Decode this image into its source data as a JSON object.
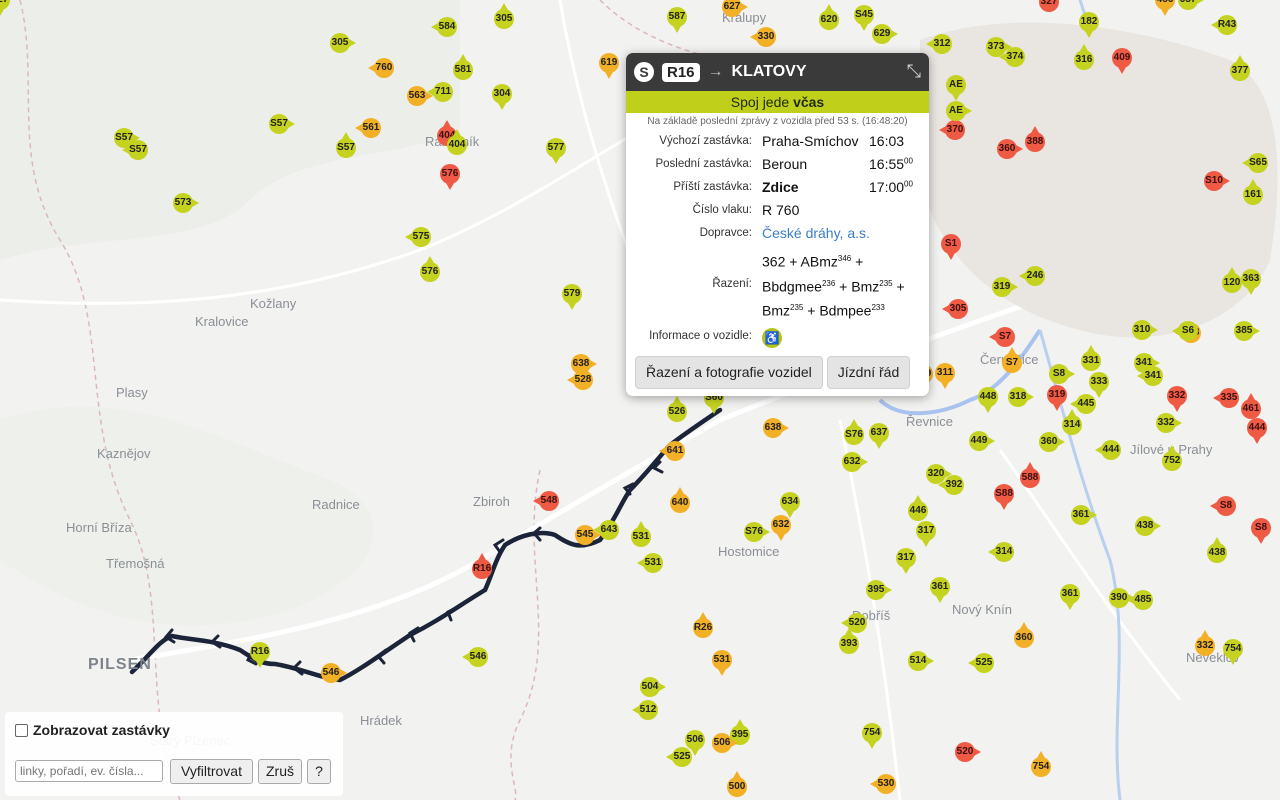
{
  "colors": {
    "ontime": "#c5d21f",
    "slight": "#f2b027",
    "late": "#ef5a44",
    "route": "#1b2438",
    "accent": "#b3c41d"
  },
  "places": [
    {
      "name": "Kožlany"
    },
    {
      "name": "Kralovice"
    },
    {
      "name": "Plasy"
    },
    {
      "name": "Kaznějov"
    },
    {
      "name": "Radnice"
    },
    {
      "name": "Zbiroh"
    },
    {
      "name": "Horní Bříza"
    },
    {
      "name": "Třemošná"
    },
    {
      "name": "PILSEN"
    },
    {
      "name": "Hrádek"
    },
    {
      "name": "Starý Plzenec"
    },
    {
      "name": "Hostomice"
    },
    {
      "name": "Dobříš"
    },
    {
      "name": "Nový Knín"
    },
    {
      "name": "Jílové u Prahy"
    },
    {
      "name": "Neveklov"
    },
    {
      "name": "Řevnice"
    },
    {
      "name": "Černošice"
    },
    {
      "name": "Rakovník"
    },
    {
      "name": "Kralupy"
    }
  ],
  "vehicles": [
    {
      "label": "305"
    },
    {
      "label": "584"
    },
    {
      "label": "305"
    },
    {
      "label": "587"
    },
    {
      "label": "627"
    },
    {
      "label": "330"
    },
    {
      "label": "620"
    },
    {
      "label": "S45"
    },
    {
      "label": "629"
    },
    {
      "label": "760"
    },
    {
      "label": "581"
    },
    {
      "label": "304"
    },
    {
      "label": "563"
    },
    {
      "label": "711"
    },
    {
      "label": "404"
    },
    {
      "label": "619"
    },
    {
      "label": "S57"
    },
    {
      "label": "561"
    },
    {
      "label": "404"
    },
    {
      "label": "577"
    },
    {
      "label": "S57"
    },
    {
      "label": "S57"
    },
    {
      "label": "S57"
    },
    {
      "label": "576"
    },
    {
      "label": "573"
    },
    {
      "label": "575"
    },
    {
      "label": "576"
    },
    {
      "label": "579"
    },
    {
      "label": "638"
    },
    {
      "label": "528"
    },
    {
      "label": "526"
    },
    {
      "label": "S60"
    },
    {
      "label": "638"
    },
    {
      "label": "641"
    },
    {
      "label": "S76"
    },
    {
      "label": "637"
    },
    {
      "label": "632"
    },
    {
      "label": "548"
    },
    {
      "label": "640"
    },
    {
      "label": "634"
    },
    {
      "label": "545"
    },
    {
      "label": "643"
    },
    {
      "label": "531"
    },
    {
      "label": "632"
    },
    {
      "label": "S76"
    },
    {
      "label": "531"
    },
    {
      "label": "R16"
    },
    {
      "label": "R16"
    },
    {
      "label": "546"
    },
    {
      "label": "546"
    },
    {
      "label": "R26"
    },
    {
      "label": "531"
    },
    {
      "label": "504"
    },
    {
      "label": "512"
    },
    {
      "label": "395"
    },
    {
      "label": "506"
    },
    {
      "label": "506"
    },
    {
      "label": "525"
    },
    {
      "label": "500"
    },
    {
      "label": "754"
    },
    {
      "label": "520"
    },
    {
      "label": "530"
    },
    {
      "label": "754"
    },
    {
      "label": "317"
    },
    {
      "label": "395"
    },
    {
      "label": "520"
    },
    {
      "label": "393"
    },
    {
      "label": "361"
    },
    {
      "label": "514"
    },
    {
      "label": "525"
    },
    {
      "label": "360"
    },
    {
      "label": "361"
    },
    {
      "label": "390"
    },
    {
      "label": "485"
    },
    {
      "label": "332"
    },
    {
      "label": "754"
    },
    {
      "label": "438"
    },
    {
      "label": "S8"
    },
    {
      "label": "438"
    },
    {
      "label": "S8"
    },
    {
      "label": "361"
    },
    {
      "label": "314"
    },
    {
      "label": "446"
    },
    {
      "label": "317"
    },
    {
      "label": "320"
    },
    {
      "label": "392"
    },
    {
      "label": "588"
    },
    {
      "label": "S88"
    },
    {
      "label": "449"
    },
    {
      "label": "444"
    },
    {
      "label": "752"
    },
    {
      "label": "332"
    },
    {
      "label": "360"
    },
    {
      "label": "335"
    },
    {
      "label": "461"
    },
    {
      "label": "444"
    },
    {
      "label": "332"
    },
    {
      "label": "445"
    },
    {
      "label": "314"
    },
    {
      "label": "333"
    },
    {
      "label": "341"
    },
    {
      "label": "341"
    },
    {
      "label": "331"
    },
    {
      "label": "448"
    },
    {
      "label": "318"
    },
    {
      "label": "S7"
    },
    {
      "label": "S7"
    },
    {
      "label": "319"
    },
    {
      "label": "S8"
    },
    {
      "label": "305"
    },
    {
      "label": "309"
    },
    {
      "label": "311"
    },
    {
      "label": "319"
    },
    {
      "label": "246"
    },
    {
      "label": "120"
    },
    {
      "label": "363"
    },
    {
      "label": "385"
    },
    {
      "label": "328"
    },
    {
      "label": "327"
    },
    {
      "label": "456"
    },
    {
      "label": "657"
    },
    {
      "label": "R43"
    },
    {
      "label": "377"
    },
    {
      "label": "182"
    },
    {
      "label": "373"
    },
    {
      "label": "374"
    },
    {
      "label": "316"
    },
    {
      "label": "409"
    },
    {
      "label": "360"
    },
    {
      "label": "370"
    },
    {
      "label": "388"
    },
    {
      "label": "AE"
    },
    {
      "label": "AE"
    },
    {
      "label": "312"
    },
    {
      "label": "161"
    },
    {
      "label": "622"
    },
    {
      "label": "S10"
    },
    {
      "label": "S65"
    },
    {
      "label": "204"
    },
    {
      "label": "S1"
    },
    {
      "label": "310"
    },
    {
      "label": "S6"
    },
    {
      "label": "333"
    },
    {
      "label": "327"
    }
  ],
  "popup": {
    "logo": "S",
    "line": "R16",
    "arrow": "→",
    "destination": "KLATOVY",
    "collapse_icon": "⤡",
    "status_prefix": "Spoj jede ",
    "status_bold": "včas",
    "last_message": "Na základě poslední zprávy z vozidla před 53 s. (16:48:20)",
    "rows": {
      "origin": {
        "label": "Výchozí zastávka:",
        "value": "Praha-Smíchov",
        "time": "16:03",
        "sec": ""
      },
      "last": {
        "label": "Poslední zastávka:",
        "value": "Beroun",
        "time": "16:55",
        "sec": "00"
      },
      "next": {
        "label": "Příští zastávka:",
        "value": "Zdice",
        "time": "17:00",
        "sec": "00"
      },
      "train_number": {
        "label": "Číslo vlaku:",
        "value": "R 760"
      },
      "operator": {
        "label": "Dopravce:",
        "value": "České dráhy, a.s."
      },
      "composition": {
        "label": "Řazení:",
        "line1a": "362 + ABmz",
        "line1sup": "346",
        "line1b": " +",
        "line2a": "Bbdgmee",
        "line2sup1": "236",
        "line2b": " + Bmz",
        "line2sup2": "235",
        "line2c": " +",
        "line3a": "Bmz",
        "line3sup1": "235",
        "line3b": " + Bdmpee",
        "line3sup2": "233"
      },
      "vehicle_info": {
        "label": "Informace o vozidle:",
        "icon": "♿"
      }
    },
    "btn_composition": "Řazení a fotografie vozidel",
    "btn_timetable": "Jízdní řád"
  },
  "filter": {
    "show_stops_label": "Zobrazovat zastávky",
    "input_placeholder": "linky, pořadí, ev. čísla...",
    "filter_btn": "Vyfiltrovat",
    "cancel_btn": "Zruš",
    "help_btn": "?"
  }
}
